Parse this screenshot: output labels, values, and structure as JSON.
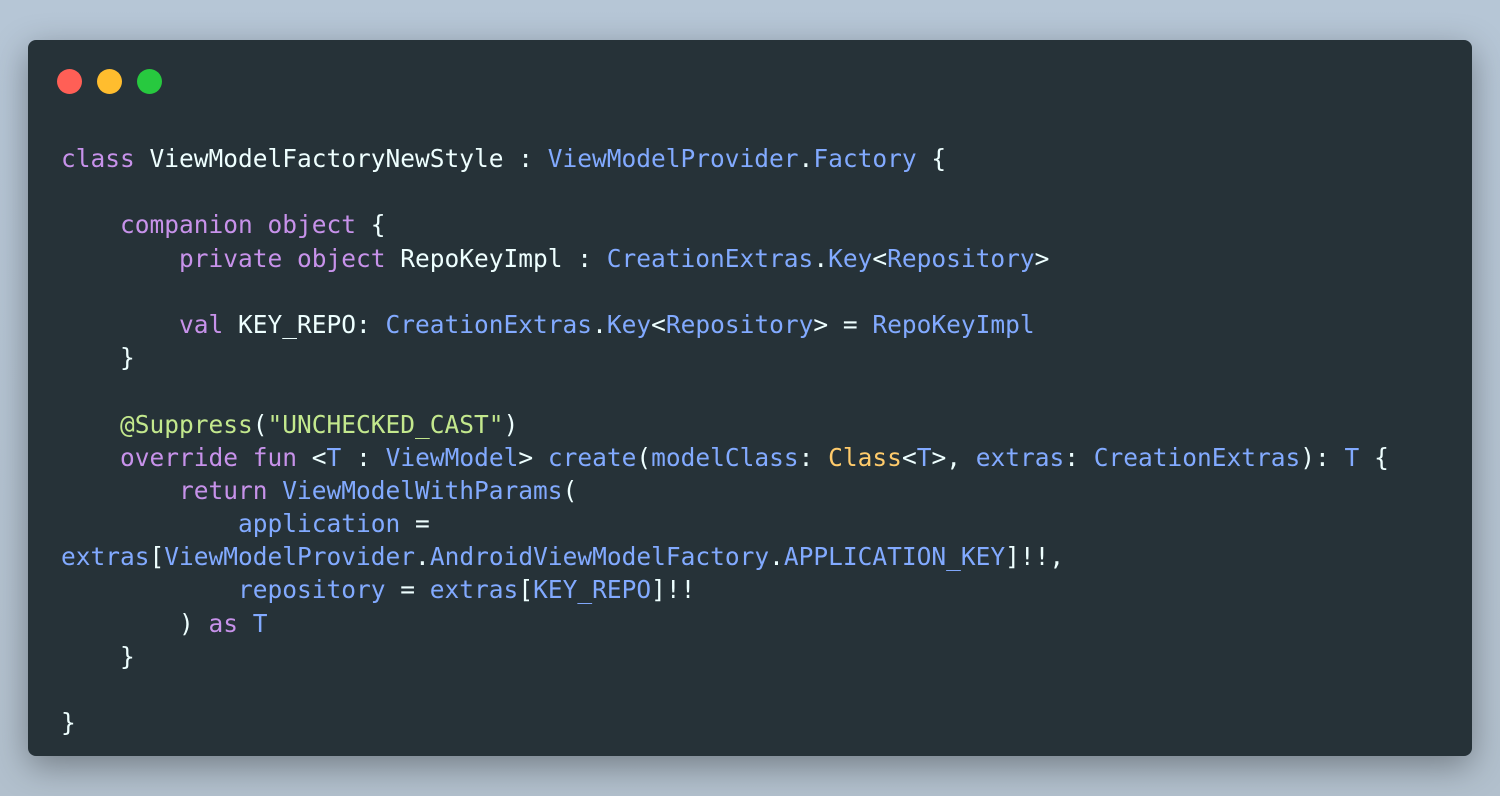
{
  "window": {
    "controls": {
      "close_color": "#ff5f56",
      "minimize_color": "#ffbd2e",
      "maximize_color": "#27c93f"
    }
  },
  "theme": {
    "background": "#263238",
    "keyword": "#c792ea",
    "type": "#82aaff",
    "string": "#c3e88d",
    "class_name": "#ffcb6b",
    "text": "#eeffff"
  },
  "code": {
    "lines": [
      [
        {
          "c": "k",
          "t": "class"
        },
        {
          "c": "w",
          "t": " ViewModelFactoryNewStyle : "
        },
        {
          "c": "t",
          "t": "ViewModelProvider"
        },
        {
          "c": "w",
          "t": "."
        },
        {
          "c": "t",
          "t": "Factory"
        },
        {
          "c": "w",
          "t": " {"
        }
      ],
      [],
      [
        {
          "c": "w",
          "t": "    "
        },
        {
          "c": "k",
          "t": "companion object"
        },
        {
          "c": "w",
          "t": " {"
        }
      ],
      [
        {
          "c": "w",
          "t": "        "
        },
        {
          "c": "k",
          "t": "private object"
        },
        {
          "c": "w",
          "t": " RepoKeyImpl : "
        },
        {
          "c": "t",
          "t": "CreationExtras"
        },
        {
          "c": "w",
          "t": "."
        },
        {
          "c": "t",
          "t": "Key"
        },
        {
          "c": "w",
          "t": "<"
        },
        {
          "c": "t",
          "t": "Repository"
        },
        {
          "c": "w",
          "t": ">"
        }
      ],
      [],
      [
        {
          "c": "w",
          "t": "        "
        },
        {
          "c": "k",
          "t": "val"
        },
        {
          "c": "w",
          "t": " KEY_REPO: "
        },
        {
          "c": "t",
          "t": "CreationExtras"
        },
        {
          "c": "w",
          "t": "."
        },
        {
          "c": "t",
          "t": "Key"
        },
        {
          "c": "w",
          "t": "<"
        },
        {
          "c": "t",
          "t": "Repository"
        },
        {
          "c": "w",
          "t": "> = "
        },
        {
          "c": "t",
          "t": "RepoKeyImpl"
        }
      ],
      [
        {
          "c": "w",
          "t": "    }"
        }
      ],
      [],
      [
        {
          "c": "w",
          "t": "    "
        },
        {
          "c": "a",
          "t": "@Suppress"
        },
        {
          "c": "w",
          "t": "("
        },
        {
          "c": "s",
          "t": "\"UNCHECKED_CAST\""
        },
        {
          "c": "w",
          "t": ")"
        }
      ],
      [
        {
          "c": "w",
          "t": "    "
        },
        {
          "c": "k",
          "t": "override fun"
        },
        {
          "c": "w",
          "t": " <"
        },
        {
          "c": "t",
          "t": "T"
        },
        {
          "c": "w",
          "t": " : "
        },
        {
          "c": "t",
          "t": "ViewModel"
        },
        {
          "c": "w",
          "t": "> "
        },
        {
          "c": "t",
          "t": "create"
        },
        {
          "c": "w",
          "t": "("
        },
        {
          "c": "t",
          "t": "modelClass"
        },
        {
          "c": "w",
          "t": ": "
        },
        {
          "c": "y",
          "t": "Class"
        },
        {
          "c": "w",
          "t": "<"
        },
        {
          "c": "t",
          "t": "T"
        },
        {
          "c": "w",
          "t": ">, "
        },
        {
          "c": "t",
          "t": "extras"
        },
        {
          "c": "w",
          "t": ": "
        },
        {
          "c": "t",
          "t": "CreationExtras"
        },
        {
          "c": "w",
          "t": "): "
        },
        {
          "c": "t",
          "t": "T"
        },
        {
          "c": "w",
          "t": " {"
        }
      ],
      [
        {
          "c": "w",
          "t": "        "
        },
        {
          "c": "k",
          "t": "return"
        },
        {
          "c": "w",
          "t": " "
        },
        {
          "c": "t",
          "t": "ViewModelWithParams"
        },
        {
          "c": "w",
          "t": "("
        }
      ],
      [
        {
          "c": "w",
          "t": "            "
        },
        {
          "c": "t",
          "t": "application"
        },
        {
          "c": "w",
          "t": " ="
        }
      ],
      [
        {
          "c": "t",
          "t": "extras"
        },
        {
          "c": "w",
          "t": "["
        },
        {
          "c": "t",
          "t": "ViewModelProvider"
        },
        {
          "c": "w",
          "t": "."
        },
        {
          "c": "t",
          "t": "AndroidViewModelFactory"
        },
        {
          "c": "w",
          "t": "."
        },
        {
          "c": "t",
          "t": "APPLICATION_KEY"
        },
        {
          "c": "w",
          "t": "]!!,"
        }
      ],
      [
        {
          "c": "w",
          "t": "            "
        },
        {
          "c": "t",
          "t": "repository"
        },
        {
          "c": "w",
          "t": " = "
        },
        {
          "c": "t",
          "t": "extras"
        },
        {
          "c": "w",
          "t": "["
        },
        {
          "c": "t",
          "t": "KEY_REPO"
        },
        {
          "c": "w",
          "t": "]!!"
        }
      ],
      [
        {
          "c": "w",
          "t": "        ) "
        },
        {
          "c": "k",
          "t": "as"
        },
        {
          "c": "w",
          "t": " "
        },
        {
          "c": "t",
          "t": "T"
        }
      ],
      [
        {
          "c": "w",
          "t": "    }"
        }
      ],
      [],
      [
        {
          "c": "w",
          "t": "}"
        }
      ]
    ]
  }
}
